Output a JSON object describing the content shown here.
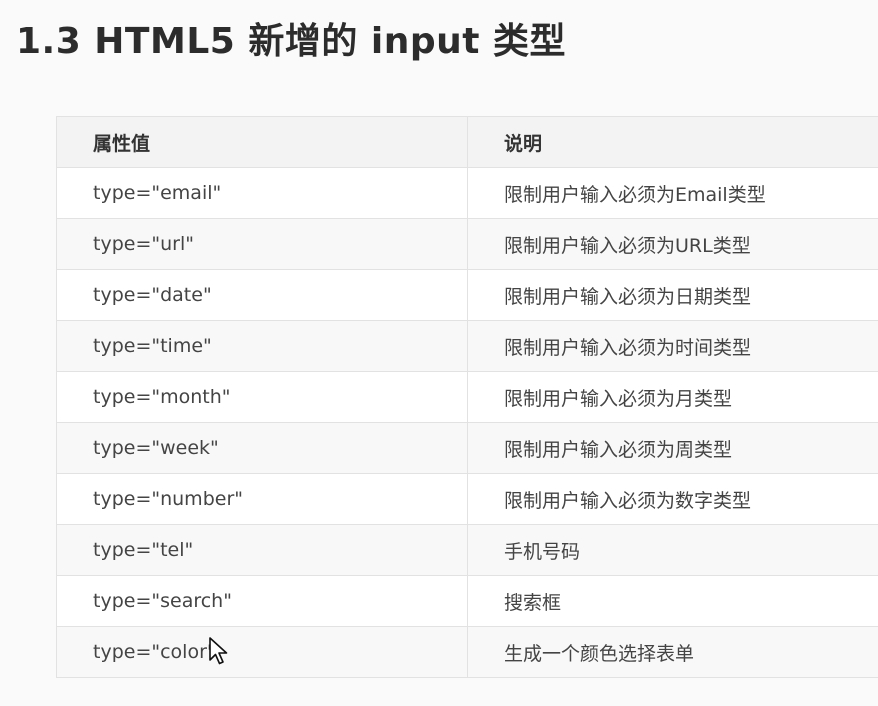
{
  "heading": "1.3 HTML5 新增的 input 类型",
  "table": {
    "headers": [
      "属性值",
      "说明"
    ],
    "rows": [
      [
        "type=\"email\"",
        "限制用户输入必须为Email类型"
      ],
      [
        "type=\"url\"",
        "限制用户输入必须为URL类型"
      ],
      [
        "type=\"date\"",
        "限制用户输入必须为日期类型"
      ],
      [
        "type=\"time\"",
        "限制用户输入必须为时间类型"
      ],
      [
        "type=\"month\"",
        "限制用户输入必须为月类型"
      ],
      [
        "type=\"week\"",
        "限制用户输入必须为周类型"
      ],
      [
        "type=\"number\"",
        "限制用户输入必须为数字类型"
      ],
      [
        "type=\"tel\"",
        "手机号码"
      ],
      [
        "type=\"search\"",
        "搜索框"
      ],
      [
        "type=\"color\"",
        "生成一个颜色选择表单"
      ]
    ]
  },
  "cursor_icon": "mouse-pointer-icon"
}
